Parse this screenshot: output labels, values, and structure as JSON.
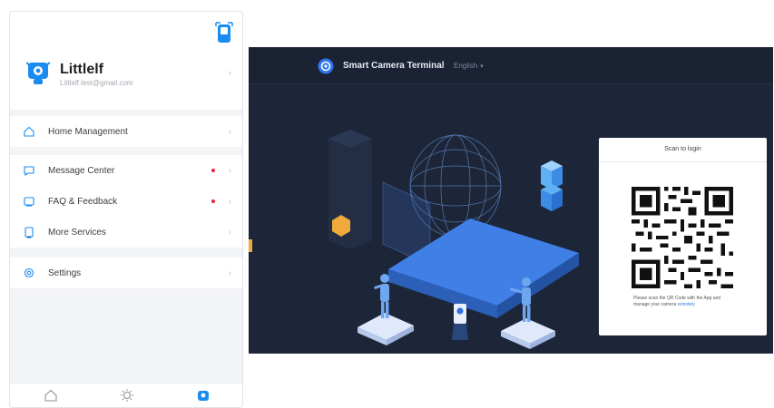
{
  "phone": {
    "user": {
      "name": "Littlelf",
      "email": "Littlelf.test@gmail.com"
    },
    "menu": [
      {
        "label": "Home Management",
        "icon": "home-icon",
        "dot": false
      },
      {
        "label": "Message Center",
        "icon": "message-icon",
        "dot": true
      },
      {
        "label": "FAQ & Feedback",
        "icon": "faq-icon",
        "dot": true
      },
      {
        "label": "More Services",
        "icon": "services-icon",
        "dot": false
      },
      {
        "label": "Settings",
        "icon": "settings-icon",
        "dot": false
      }
    ],
    "tabs": [
      "home-tab-icon",
      "smart-tab-icon",
      "me-tab-icon"
    ],
    "accent": "#1a8cf0"
  },
  "web": {
    "title": "Smart Camera Terminal",
    "language": "English",
    "card": {
      "title": "Scan to login",
      "hint": "Please scan the QR Code with the App and manage your camera",
      "hint_link": "remotely"
    },
    "background": "#1d2638",
    "accent": "#3b7cf6"
  }
}
